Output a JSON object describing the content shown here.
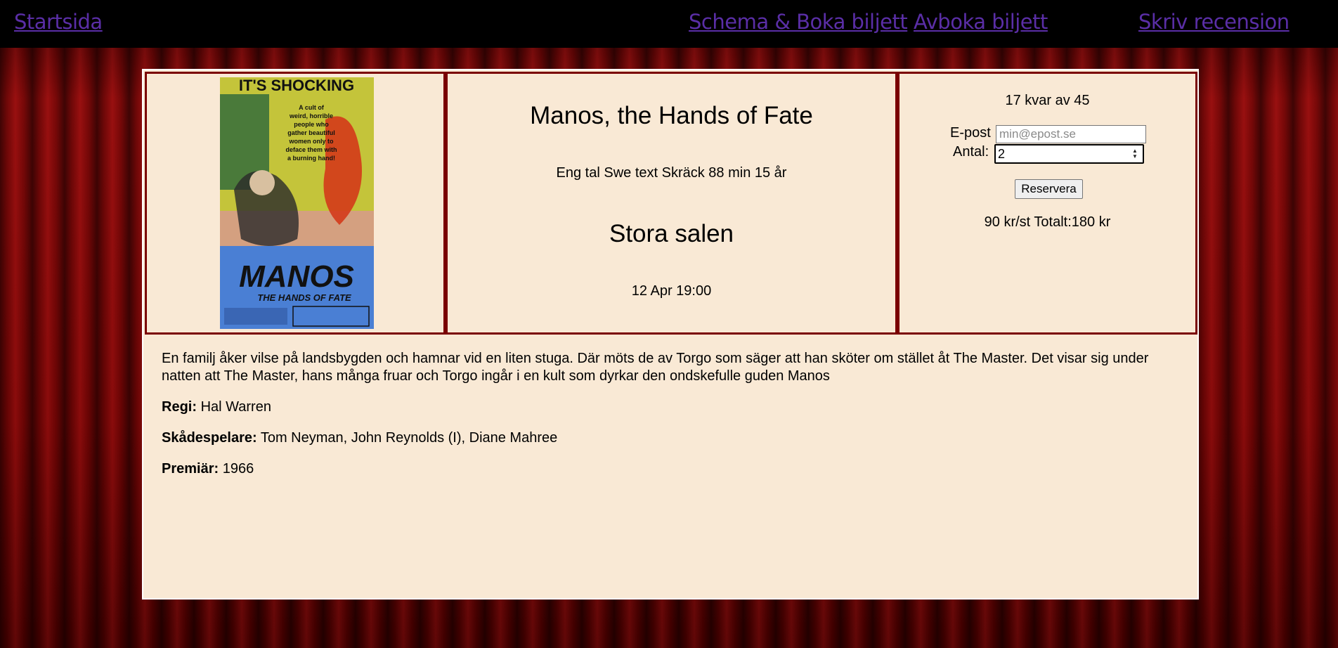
{
  "nav": {
    "home": "Startsida",
    "schedule": "Schema & Boka biljett",
    "cancel": "Avboka biljett",
    "review": "Skriv recension"
  },
  "movie": {
    "title": "Manos, the Hands of Fate",
    "meta": "Eng tal Swe text Skräck 88 min 15 år",
    "room": "Stora salen",
    "time": "12 Apr 19:00",
    "poster": {
      "headline": "IT'S SHOCKING",
      "tagline": [
        "A cult of",
        "weird, horrible",
        "people who",
        "gather beautiful",
        "women only to",
        "deface them with",
        "a burning hand!"
      ],
      "logo": "MANOS",
      "subtitle": "THE HANDS OF FATE",
      "colors": {
        "top": "#c4c43a",
        "middle": "#4a7a3a",
        "bottom": "#4a7fd4",
        "red": "#d43a1a"
      }
    }
  },
  "booking": {
    "seats": "17 kvar av 45",
    "email_label": "E-post",
    "email_placeholder": "min@epost.se",
    "qty_label": "Antal:",
    "qty_value": "2",
    "reserve_label": "Reservera",
    "price": "90 kr/st Totalt:180 kr"
  },
  "details": {
    "description": "En familj åker vilse på landsbygden och hamnar vid en liten stuga. Där möts de av Torgo som säger att han sköter om stället åt The Master. Det visar sig under natten att The Master, hans många fruar och Torgo ingår i en kult som dyrkar den ondskefulle guden Manos",
    "director_label": "Regi:",
    "director": "Hal Warren",
    "actors_label": "Skådespelare:",
    "actors": "Tom Neyman, John Reynolds (I), Diane Mahree",
    "premiere_label": "Premiär:",
    "premiere": "1966"
  },
  "colors": {
    "panel": "#f9e9d5",
    "border": "#7a0000",
    "link": "#5a2ea6",
    "navbar": "#000000"
  }
}
